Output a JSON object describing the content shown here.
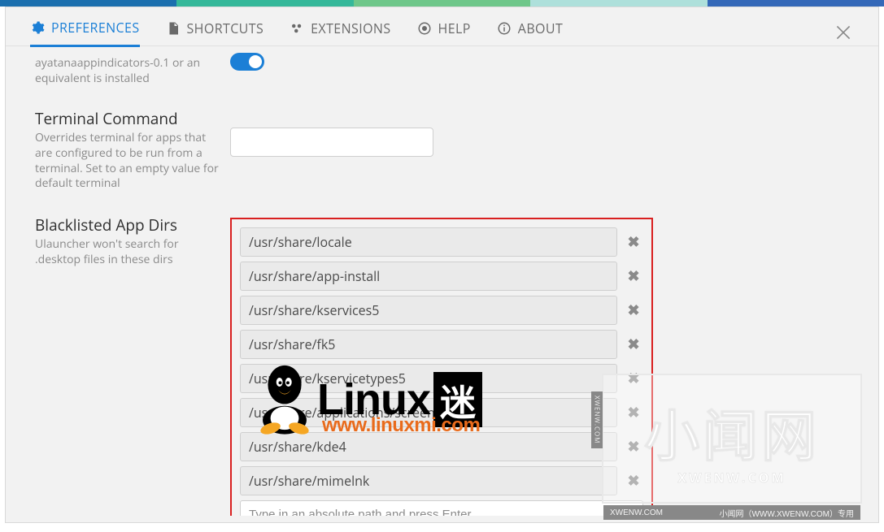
{
  "tabs": {
    "preferences": "PREFERENCES",
    "shortcuts": "SHORTCUTS",
    "extensions": "EXTENSIONS",
    "help": "HELP",
    "about": "ABOUT"
  },
  "tray": {
    "desc_line1": "ayatanaappindicators-0.1 or an",
    "desc_line2": "equivalent is installed"
  },
  "terminal": {
    "title": "Terminal Command",
    "desc": "Overrides terminal for apps that are configured to be run from a terminal. Set to an empty value for default terminal",
    "value": ""
  },
  "blacklist": {
    "title": "Blacklisted App Dirs",
    "desc": "Ulauncher won't search for .desktop files in these dirs",
    "entries": [
      "/usr/share/locale",
      "/usr/share/app-install",
      "/usr/share/kservices5",
      "/usr/share/fk5",
      "/usr/share/kservicetypes5",
      "/usr/share/applications/screensavers",
      "/usr/share/kde4",
      "/usr/share/mimelnk"
    ],
    "placeholder": "Type in an absolute path and press Enter"
  },
  "overlay": {
    "linux_text": "Linux",
    "linux_mi": "迷",
    "linux_url": "www.linuxmi.com",
    "xwen_main": "小闻网",
    "xwen_sub": "XWENW.COM",
    "xwen_left": "XWENW.COM",
    "xwen_right": "小闻网（WWW.XWENW.COM）专用",
    "xwen_side": "XWENW.COM"
  }
}
